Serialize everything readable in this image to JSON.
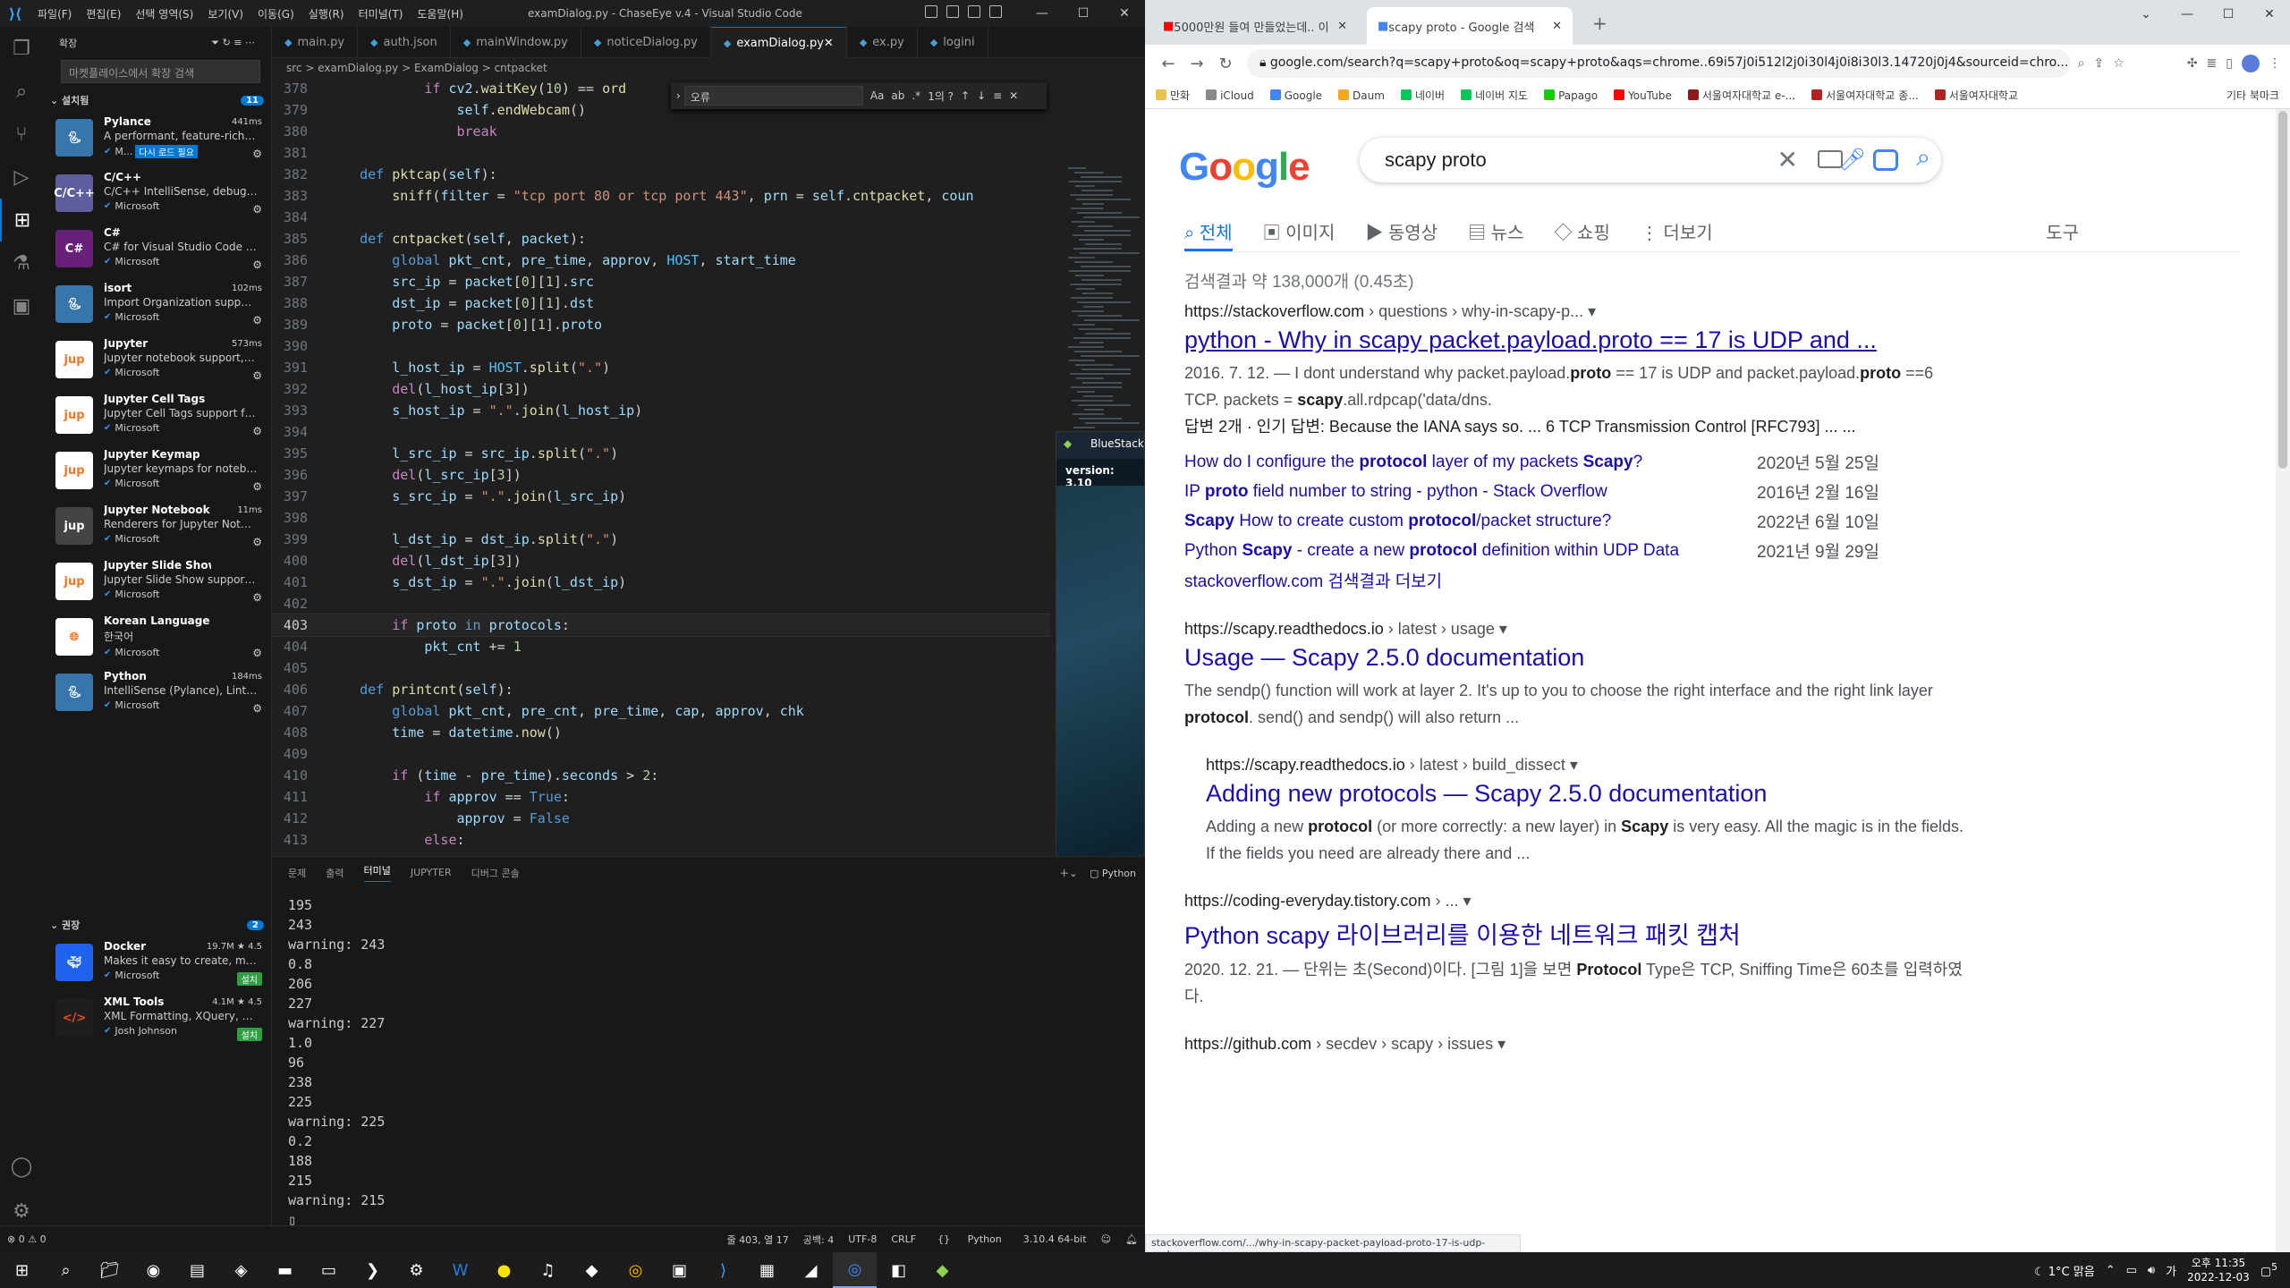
{
  "vscode": {
    "menu": [
      "파일(F)",
      "편집(E)",
      "선택 영역(S)",
      "보기(V)",
      "이동(G)",
      "실행(R)",
      "터미널(T)",
      "도움말(H)"
    ],
    "window_title": "examDialog.py - ChaseEye v.4 - Visual Studio Code",
    "sidebar": {
      "header": "확장",
      "search_placeholder": "마켓플레이스에서 확장 검색",
      "installed_label": "설치됨",
      "installed_count": "11",
      "recommended_label": "권장",
      "recommended_count": "2",
      "installed": [
        {
          "name": "Pylance",
          "meta": "441ms",
          "desc": "A performant, feature-rich la...",
          "pub": "M...",
          "reload": "다시 로드 필요",
          "icon": "python",
          "color": "#3776ab"
        },
        {
          "name": "C/C++",
          "meta": "",
          "desc": "C/C++ IntelliSense, debuggi...",
          "pub": "Microsoft",
          "icon": "C/C++",
          "color": "#5e5e9e"
        },
        {
          "name": "C#",
          "meta": "",
          "desc": "C# for Visual Studio Code (p...",
          "pub": "Microsoft",
          "icon": "C#",
          "color": "#68217a"
        },
        {
          "name": "isort",
          "meta": "102ms",
          "desc": "Import Organization suppor...",
          "pub": "Microsoft",
          "icon": "python",
          "color": "#3776ab"
        },
        {
          "name": "Jupyter",
          "meta": "573ms",
          "desc": "Jupyter notebook support, i...",
          "pub": "Microsoft",
          "icon": "jupyter",
          "color": "#ffffff"
        },
        {
          "name": "Jupyter Cell Tags",
          "meta": "",
          "desc": "Jupyter Cell Tags support for...",
          "pub": "Microsoft",
          "icon": "jupyter",
          "color": "#ffffff"
        },
        {
          "name": "Jupyter Keymap",
          "meta": "",
          "desc": "Jupyter keymaps for notebo...",
          "pub": "Microsoft",
          "icon": "jupyter",
          "color": "#ffffff"
        },
        {
          "name": "Jupyter Notebook ...",
          "meta": "11ms",
          "desc": "Renderers for Jupyter Noteb...",
          "pub": "Microsoft",
          "icon": "jupyter",
          "color": "#444444"
        },
        {
          "name": "Jupyter Slide Show",
          "meta": "",
          "desc": "Jupyter Slide Show support ...",
          "pub": "Microsoft",
          "icon": "jupyter",
          "color": "#ffffff"
        },
        {
          "name": "Korean Language Pack for...",
          "meta": "",
          "desc": "한국어",
          "pub": "Microsoft",
          "icon": "globe",
          "color": "#ffffff"
        },
        {
          "name": "Python",
          "meta": "184ms",
          "desc": "IntelliSense (Pylance), Lintin...",
          "pub": "Microsoft",
          "icon": "python",
          "color": "#3776ab"
        }
      ],
      "recommended": [
        {
          "name": "Docker",
          "meta": "19.7M ★ 4.5",
          "desc": "Makes it easy to create, man...",
          "pub": "Microsoft",
          "install": "설치",
          "icon": "docker",
          "color": "#1d63ed"
        },
        {
          "name": "XML Tools",
          "meta": "4.1M ★ 4.5",
          "desc": "XML Formatting, XQuery, an...",
          "pub": "Josh Johnson",
          "install": "설치",
          "icon": "xml",
          "color": "#1e1e1e"
        }
      ]
    },
    "tabs": [
      {
        "label": "main.py",
        "active": false
      },
      {
        "label": "auth.json",
        "active": false
      },
      {
        "label": "mainWindow.py",
        "active": false
      },
      {
        "label": "noticeDialog.py",
        "active": false
      },
      {
        "label": "examDialog.py",
        "active": true
      },
      {
        "label": "ex.py",
        "active": false
      },
      {
        "label": "logini",
        "active": false
      }
    ],
    "breadcrumb": "src > examDialog.py > ExamDialog > cntpacket",
    "find": {
      "value": "오류",
      "result": "1의 ?"
    },
    "code": [
      {
        "n": "378",
        "html": "            <span class='k'>if</span> <span class='v'>cv2</span>.<span class='f'>waitKey</span>(<span class='n'>10</span>) == <span class='f'>ord</span>"
      },
      {
        "n": "379",
        "html": "                <span class='sf'>self</span>.<span class='f'>endWebcam</span>()"
      },
      {
        "n": "380",
        "html": "                <span class='k'>break</span>"
      },
      {
        "n": "381",
        "html": ""
      },
      {
        "n": "382",
        "html": "    <span class='kd'>def</span> <span class='f'>pktcap</span>(<span class='sf'>self</span>):"
      },
      {
        "n": "383",
        "html": "        <span class='f'>sniff</span>(<span class='v'>filter</span> = <span class='s'>\"tcp port 80 or tcp port 443\"</span>, <span class='v'>prn</span> = <span class='sf'>self</span>.<span class='f'>cntpacket</span>, <span class='v'>coun</span>"
      },
      {
        "n": "384",
        "html": ""
      },
      {
        "n": "385",
        "html": "    <span class='kd'>def</span> <span class='f'>cntpacket</span>(<span class='sf'>self</span>, <span class='v'>packet</span>):"
      },
      {
        "n": "386",
        "html": "        <span class='kd'>global</span> <span class='v'>pkt_cnt</span>, <span class='v'>pre_time</span>, <span class='v'>approv</span>, <span class='c'>HOST</span>, <span class='v'>start_time</span>"
      },
      {
        "n": "387",
        "html": "        <span class='v'>src_ip</span> = <span class='v'>packet</span>[<span class='n'>0</span>][<span class='n'>1</span>].<span class='v'>src</span>"
      },
      {
        "n": "388",
        "html": "        <span class='v'>dst_ip</span> = <span class='v'>packet</span>[<span class='n'>0</span>][<span class='n'>1</span>].<span class='v'>dst</span>"
      },
      {
        "n": "389",
        "html": "        <span class='v'>proto</span> = <span class='v'>packet</span>[<span class='n'>0</span>][<span class='n'>1</span>].<span class='v'>proto</span>"
      },
      {
        "n": "390",
        "html": ""
      },
      {
        "n": "391",
        "html": "        <span class='v'>l_host_ip</span> = <span class='c'>HOST</span>.<span class='f'>split</span>(<span class='s'>\".\"</span>)"
      },
      {
        "n": "392",
        "html": "        <span class='k'>del</span>(<span class='v'>l_host_ip</span>[<span class='n'>3</span>])"
      },
      {
        "n": "393",
        "html": "        <span class='v'>s_host_ip</span> = <span class='s'>\".\"</span>.<span class='f'>join</span>(<span class='v'>l_host_ip</span>)"
      },
      {
        "n": "394",
        "html": ""
      },
      {
        "n": "395",
        "html": "        <span class='v'>l_src_ip</span> = <span class='v'>src_ip</span>.<span class='f'>split</span>(<span class='s'>\".\"</span>)"
      },
      {
        "n": "396",
        "html": "        <span class='k'>del</span>(<span class='v'>l_src_ip</span>[<span class='n'>3</span>])"
      },
      {
        "n": "397",
        "html": "        <span class='v'>s_src_ip</span> = <span class='s'>\".\"</span>.<span class='f'>join</span>(<span class='v'>l_src_ip</span>)"
      },
      {
        "n": "398",
        "html": ""
      },
      {
        "n": "399",
        "html": "        <span class='v'>l_dst_ip</span> = <span class='v'>dst_ip</span>.<span class='f'>split</span>(<span class='s'>\".\"</span>)"
      },
      {
        "n": "400",
        "html": "        <span class='k'>del</span>(<span class='v'>l_dst_ip</span>[<span class='n'>3</span>])"
      },
      {
        "n": "401",
        "html": "        <span class='v'>s_dst_ip</span> = <span class='s'>\".\"</span>.<span class='f'>join</span>(<span class='v'>l_dst_ip</span>)"
      },
      {
        "n": "402",
        "html": ""
      },
      {
        "n": "403",
        "html": "        <span class='k'>if</span> <span class='v'>proto</span> <span class='kd'>in</span> <span class='v'>protocols</span>:",
        "cur": true
      },
      {
        "n": "404",
        "html": "            <span class='v'>pkt_cnt</span> += <span class='n'>1</span>"
      },
      {
        "n": "405",
        "html": ""
      },
      {
        "n": "406",
        "html": "    <span class='kd'>def</span> <span class='f'>printcnt</span>(<span class='sf'>self</span>):"
      },
      {
        "n": "407",
        "html": "        <span class='kd'>global</span> <span class='v'>pkt_cnt</span>, <span class='v'>pre_cnt</span>, <span class='v'>pre_time</span>, <span class='v'>cap</span>, <span class='v'>approv</span>, <span class='v'>chk</span>"
      },
      {
        "n": "408",
        "html": "        <span class='v'>time</span> = <span class='v'>datetime</span>.<span class='f'>now</span>()"
      },
      {
        "n": "409",
        "html": ""
      },
      {
        "n": "410",
        "html": "        <span class='k'>if</span> (<span class='v'>time</span> - <span class='v'>pre_time</span>).<span class='v'>seconds</span> > <span class='n'>2</span>:"
      },
      {
        "n": "411",
        "html": "            <span class='k'>if</span> <span class='v'>approv</span> == <span class='kd'>True</span>:"
      },
      {
        "n": "412",
        "html": "                <span class='v'>approv</span> = <span class='kd'>False</span>"
      },
      {
        "n": "413",
        "html": "            <span class='k'>else</span>:"
      }
    ],
    "panel": {
      "tabs": [
        "문제",
        "출력",
        "터미널",
        "JUPYTER",
        "디버그 콘솔"
      ],
      "active_tab": "터미널",
      "shell": "Python",
      "terminal_lines": [
        "195",
        "243",
        "warning: 243",
        "0.8",
        "206",
        "227",
        "warning: 227",
        "1.0",
        "96",
        "238",
        "225",
        "warning: 225",
        "0.2",
        "188",
        "215",
        "warning: 215"
      ]
    },
    "status": {
      "errors": "⊗ 0 ⚠ 0",
      "position": "줄 403, 열 17",
      "spaces": "공백: 4",
      "encoding": "UTF-8",
      "eol": "CRLF",
      "language": "Python",
      "interpreter": "3.10.4 64-bit"
    },
    "bluestacks": {
      "title": "BlueStack",
      "version": "version: 3.10"
    }
  },
  "chrome": {
    "tabs": [
      {
        "label": "5000만원 들여 만들었는데.. 이",
        "active": false,
        "icon_color": "#ff0000"
      },
      {
        "label": "scapy proto - Google 검색",
        "active": true,
        "icon_color": "#4285f4"
      }
    ],
    "url": "google.com/search?q=scapy+proto&oq=scapy+proto&aqs=chrome..69i57j0i512l2j0i30l4j0i8i30l3.14720j0j4&sourceid=chro...",
    "bookmarks": [
      {
        "label": "만화",
        "color": "#e8c34b"
      },
      {
        "label": "iCloud",
        "color": "#888888"
      },
      {
        "label": "Google",
        "color": "#4285f4"
      },
      {
        "label": "Daum",
        "color": "#f5a623"
      },
      {
        "label": "네이버",
        "color": "#03c75a"
      },
      {
        "label": "네이버 지도",
        "color": "#03c75a"
      },
      {
        "label": "Papago",
        "color": "#1ec800"
      },
      {
        "label": "YouTube",
        "color": "#ff0000"
      },
      {
        "label": "서울여자대학교 e-...",
        "color": "#8b1a1a"
      },
      {
        "label": "서울여자대학교 종...",
        "color": "#b22222"
      },
      {
        "label": "서울여자대학교",
        "color": "#b22222"
      }
    ],
    "bookmarks_other": "기타 북마크",
    "google": {
      "query": "scapy proto",
      "tabs": [
        "전체",
        "이미지",
        "동영상",
        "뉴스",
        "쇼핑",
        "더보기"
      ],
      "tools": "도구",
      "result_count": "검색결과 약 138,000개 (0.45초)",
      "results": [
        {
          "domain": "https://stackoverflow.com",
          "path": " › questions › why-in-scapy-p...",
          "title": "python - Why in scapy packet.payload.proto == 17 is UDP and ...",
          "underline": true,
          "snippet_html": "2016. 7. 12. — I dont understand why packet.payload.<b>proto</b> == 17 is UDP and packet.payload.<b>proto</b> ==6 TCP. packets = <b>scapy</b>.all.rdpcap('data/dns.",
          "extra": "답변 2개 · 인기 답변: Because the IANA says so. ... 6 TCP Transmission Control [RFC793] ... ...",
          "sublinks": [
            {
              "html": "How do I configure the <b>protocol</b> layer of my packets <b>Scapy</b>?",
              "date": "2020년 5월 25일"
            },
            {
              "html": "IP <b>proto</b> field number to string - python - Stack Overflow",
              "date": "2016년 2월 16일"
            },
            {
              "html": "<b>Scapy</b> How to create custom <b>protocol</b>/packet structure?",
              "date": "2022년 6월 10일"
            },
            {
              "html": "Python <b>Scapy</b> - create a new <b>protocol</b> definition within UDP Data",
              "date": "2021년 9월 29일"
            }
          ],
          "more": "stackoverflow.com 검색결과 더보기"
        },
        {
          "domain": "https://scapy.readthedocs.io",
          "path": " › latest › usage",
          "title": "Usage — Scapy 2.5.0 documentation",
          "snippet_html": "The sendp() function will work at layer 2. It's up to you to choose the right interface and the right link layer <b>protocol</b>. send() and sendp() will also return ..."
        },
        {
          "domain": "https://scapy.readthedocs.io",
          "path": " › latest › build_dissect",
          "title": "Adding new protocols — Scapy 2.5.0 documentation",
          "snippet_html": "Adding a new <b>protocol</b> (or more correctly: a new layer) in <b>Scapy</b> is very easy. All the magic is in the fields. If the fields you need are already there and ...",
          "sub": true
        },
        {
          "domain": "https://coding-everyday.tistory.com",
          "path": " › ...",
          "title": "Python scapy 라이브러리를 이용한 네트워크 패킷 캡처",
          "snippet_html": "2020. 12. 21. — 단위는 초(Second)이다. [그림 1]을 보면 <b>Protocol</b> Type은 TCP, Sniffing Time은 60초를 입력하였다."
        },
        {
          "domain": "https://github.com",
          "path": " › secdev › scapy › issues",
          "title": "",
          "snippet_html": ""
        }
      ]
    },
    "status_url": "stackoverflow.com/.../why-in-scapy-packet-payload-proto-17-is-udp-and-..."
  },
  "taskbar": {
    "weather": "1°C 맑음",
    "time": "오후 11:35",
    "date": "2022-12-03",
    "notif": "5"
  }
}
